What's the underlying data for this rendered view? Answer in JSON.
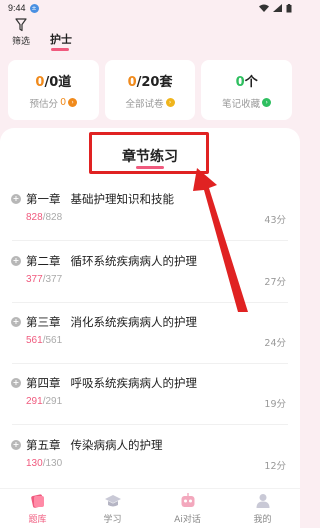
{
  "status_bar": {
    "time": "9:44",
    "notif_badge": "±"
  },
  "filter": {
    "label": "筛选"
  },
  "tabs": [
    {
      "label": "护士",
      "active": true
    }
  ],
  "stats": [
    {
      "done": "0",
      "total": "/0道",
      "sub_label": "预估分",
      "sub_value": "0",
      "sub_color": "#f08a1c"
    },
    {
      "done": "0",
      "total": "/20套",
      "sub_label": "全部试卷",
      "sub_value": "",
      "sub_color": "#f0b51c"
    },
    {
      "done": "0",
      "total": "个",
      "sub_label": "笔记收藏",
      "sub_value": "",
      "sub_color": "#2fbf60"
    }
  ],
  "colors": {
    "accent": "#f05a7e",
    "orange": "#f08a1c",
    "green": "#2fbf60",
    "annotation": "#e02222"
  },
  "section": {
    "title": "章节练习"
  },
  "chapters": [
    {
      "num": "第一章",
      "name": "基础护理知识和技能",
      "done": "828",
      "total": "/828",
      "score": "43分"
    },
    {
      "num": "第二章",
      "name": "循环系统疾病病人的护理",
      "done": "377",
      "total": "/377",
      "score": "27分"
    },
    {
      "num": "第三章",
      "name": "消化系统疾病病人的护理",
      "done": "561",
      "total": "/561",
      "score": "24分"
    },
    {
      "num": "第四章",
      "name": "呼吸系统疾病病人的护理",
      "done": "291",
      "total": "/291",
      "score": "19分"
    },
    {
      "num": "第五章",
      "name": "传染病病人的护理",
      "done": "130",
      "total": "/130",
      "score": "12分"
    }
  ],
  "bottom_nav": [
    {
      "label": "题库",
      "icon": "book-icon",
      "active": true
    },
    {
      "label": "学习",
      "icon": "graduation-cap-icon",
      "active": false
    },
    {
      "label": "Ai对话",
      "icon": "ai-robot-icon",
      "active": false
    },
    {
      "label": "我的",
      "icon": "person-icon",
      "active": false
    }
  ]
}
